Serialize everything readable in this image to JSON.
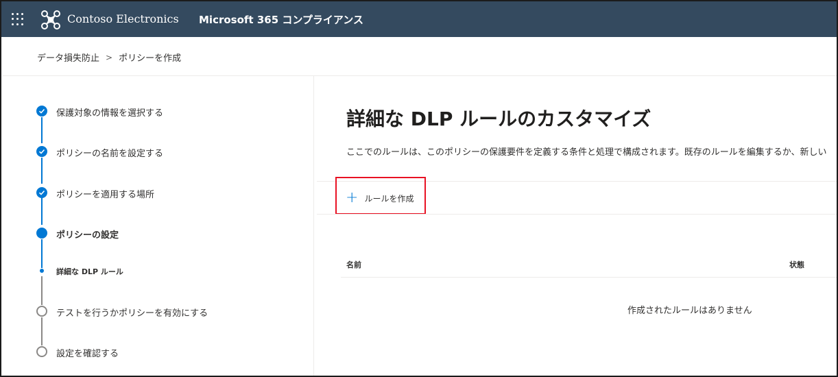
{
  "header": {
    "org_name": "Contoso Electronics",
    "app_name": "Microsoft 365 コンプライアンス",
    "colors": {
      "bar": "#344a5f",
      "text": "#ffffff"
    }
  },
  "breadcrumb": {
    "items": [
      "データ損失防止",
      "ポリシーを作成"
    ],
    "separator": ">"
  },
  "steps": [
    {
      "label": "保護対象の情報を選択する",
      "status": "completed"
    },
    {
      "label": "ポリシーの名前を設定する",
      "status": "completed"
    },
    {
      "label": "ポリシーを適用する場所",
      "status": "completed"
    },
    {
      "label": "ポリシーの設定",
      "status": "current"
    },
    {
      "label": "詳細な DLP ルール",
      "status": "current-substep"
    },
    {
      "label": "テストを行うかポリシーを有効にする",
      "status": "not-started"
    },
    {
      "label": "設定を確認する",
      "status": "not-started"
    }
  ],
  "main": {
    "title": "詳細な DLP ルールのカスタマイズ",
    "description": "ここでのルールは、このポリシーの保護要件を定義する条件と処理で構成されます。既存のルールを編集するか、新しい",
    "create_rule_label": "ルールを作成",
    "table": {
      "columns": [
        "名前",
        "状態"
      ],
      "empty_message": "作成されたルールはありません"
    }
  },
  "colors": {
    "accent": "#0078d4",
    "highlight": "#e81123",
    "inactive": "#8a8886"
  }
}
